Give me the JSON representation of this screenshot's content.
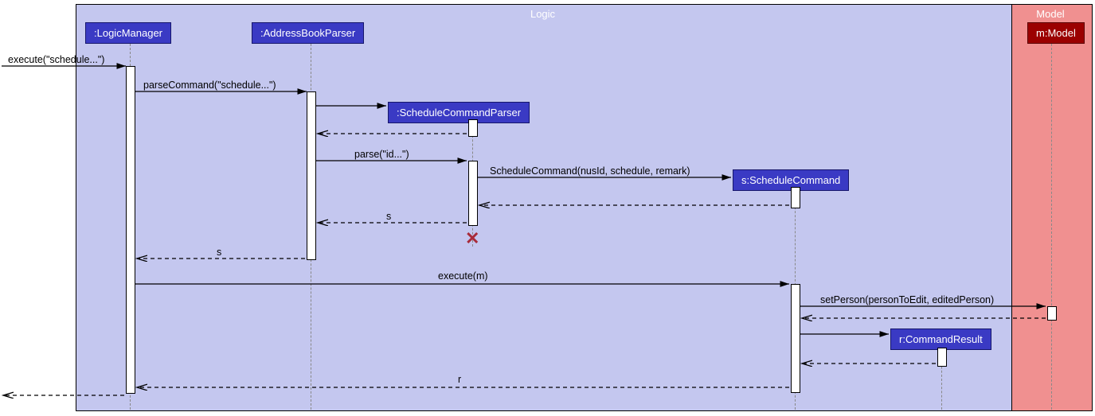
{
  "frames": {
    "logic": "Logic",
    "model": "Model"
  },
  "participants": {
    "logicManager": ":LogicManager",
    "addressBookParser": ":AddressBookParser",
    "scheduleCommandParser": ":ScheduleCommandParser",
    "scheduleCommand": "s:ScheduleCommand",
    "commandResult": "r:CommandResult",
    "model": "m:Model"
  },
  "messages": {
    "execute1": "execute(\"schedule...\")",
    "parseCommand": "parseCommand(\"schedule...\")",
    "parseId": "parse(\"id...\")",
    "scheduleCtor": "ScheduleCommand(nusId, schedule, remark)",
    "retS1": "s",
    "retS2": "s",
    "executeM": "execute(m)",
    "setPerson": "setPerson(personToEdit, editedPerson)",
    "retR": "r"
  }
}
